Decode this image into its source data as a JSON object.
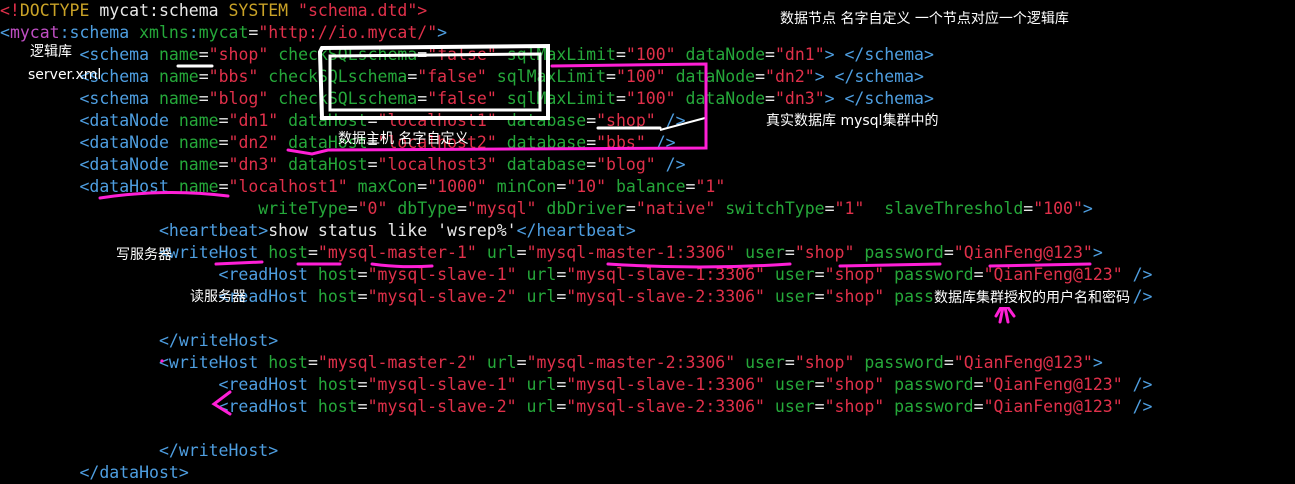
{
  "colors": {
    "background": "#000000",
    "text": "#e8e8e8",
    "tag": "#4e9ee0",
    "attribute": "#25a83a",
    "string": "#e0304a",
    "keyword": "#c9a227",
    "namespace": "#c04fc4",
    "pen_white": "#ffffff",
    "pen_magenta": "#ff1fd6"
  },
  "lines": [
    [
      [
        "doc",
        "<!"
      ],
      [
        "kw",
        "DOCTYPE"
      ],
      [
        "text",
        " mycat:schema "
      ],
      [
        "kw",
        "SYSTEM"
      ],
      [
        "text",
        " "
      ],
      [
        "str",
        "\"schema.dtd\""
      ],
      [
        "doc",
        ">"
      ]
    ],
    [
      [
        "tag",
        "<"
      ],
      [
        "ns",
        "mycat"
      ],
      [
        "tag",
        ":schema "
      ],
      [
        "attr",
        "xmlns"
      ],
      [
        "tag",
        ":"
      ],
      [
        "attr",
        "mycat"
      ],
      [
        "text",
        "="
      ],
      [
        "str",
        "\"http://io.mycat/\""
      ],
      [
        "tag",
        ">"
      ]
    ],
    [
      [
        "text",
        "        "
      ],
      [
        "tag",
        "<schema "
      ],
      [
        "attr",
        "name"
      ],
      [
        "text",
        "="
      ],
      [
        "str",
        "\"shop\""
      ],
      [
        "text",
        " "
      ],
      [
        "attr",
        "checkSQLschema"
      ],
      [
        "text",
        "="
      ],
      [
        "str",
        "\"false\""
      ],
      [
        "text",
        " "
      ],
      [
        "attr",
        "sqlMaxLimit"
      ],
      [
        "text",
        "="
      ],
      [
        "str",
        "\"100\""
      ],
      [
        "text",
        " "
      ],
      [
        "attr",
        "dataNode"
      ],
      [
        "text",
        "="
      ],
      [
        "str",
        "\"dn1\""
      ],
      [
        "tag",
        "> </schema>"
      ]
    ],
    [
      [
        "text",
        "        "
      ],
      [
        "tag",
        "<schema "
      ],
      [
        "attr",
        "name"
      ],
      [
        "text",
        "="
      ],
      [
        "str",
        "\"bbs\""
      ],
      [
        "text",
        " "
      ],
      [
        "attr",
        "checkSQLschema"
      ],
      [
        "text",
        "="
      ],
      [
        "str",
        "\"false\""
      ],
      [
        "text",
        " "
      ],
      [
        "attr",
        "sqlMaxLimit"
      ],
      [
        "text",
        "="
      ],
      [
        "str",
        "\"100\""
      ],
      [
        "text",
        " "
      ],
      [
        "attr",
        "dataNode"
      ],
      [
        "text",
        "="
      ],
      [
        "str",
        "\"dn2\""
      ],
      [
        "tag",
        "> </schema>"
      ]
    ],
    [
      [
        "text",
        "        "
      ],
      [
        "tag",
        "<schema "
      ],
      [
        "attr",
        "name"
      ],
      [
        "text",
        "="
      ],
      [
        "str",
        "\"blog\""
      ],
      [
        "text",
        " "
      ],
      [
        "attr",
        "checkSQLschema"
      ],
      [
        "text",
        "="
      ],
      [
        "str",
        "\"false\""
      ],
      [
        "text",
        " "
      ],
      [
        "attr",
        "sqlMaxLimit"
      ],
      [
        "text",
        "="
      ],
      [
        "str",
        "\"100\""
      ],
      [
        "text",
        " "
      ],
      [
        "attr",
        "dataNode"
      ],
      [
        "text",
        "="
      ],
      [
        "str",
        "\"dn3\""
      ],
      [
        "tag",
        "> </schema>"
      ]
    ],
    [
      [
        "text",
        "        "
      ],
      [
        "tag",
        "<dataNode "
      ],
      [
        "attr",
        "name"
      ],
      [
        "text",
        "="
      ],
      [
        "str",
        "\"dn1\""
      ],
      [
        "text",
        " "
      ],
      [
        "attr",
        "dataHost"
      ],
      [
        "text",
        "="
      ],
      [
        "str",
        "\"localhost1\""
      ],
      [
        "text",
        " "
      ],
      [
        "attr",
        "database"
      ],
      [
        "text",
        "="
      ],
      [
        "str",
        "\"shop\""
      ],
      [
        "text",
        " "
      ],
      [
        "tag",
        "/>"
      ]
    ],
    [
      [
        "text",
        "        "
      ],
      [
        "tag",
        "<dataNode "
      ],
      [
        "attr",
        "name"
      ],
      [
        "text",
        "="
      ],
      [
        "str",
        "\"dn2\""
      ],
      [
        "text",
        " "
      ],
      [
        "attr",
        "dataHost"
      ],
      [
        "text",
        "="
      ],
      [
        "str",
        "\"localhost2\""
      ],
      [
        "text",
        " "
      ],
      [
        "attr",
        "database"
      ],
      [
        "text",
        "="
      ],
      [
        "str",
        "\"bbs\""
      ],
      [
        "text",
        " "
      ],
      [
        "tag",
        "/>"
      ]
    ],
    [
      [
        "text",
        "        "
      ],
      [
        "tag",
        "<dataNode "
      ],
      [
        "attr",
        "name"
      ],
      [
        "text",
        "="
      ],
      [
        "str",
        "\"dn3\""
      ],
      [
        "text",
        " "
      ],
      [
        "attr",
        "dataHost"
      ],
      [
        "text",
        "="
      ],
      [
        "str",
        "\"localhost3\""
      ],
      [
        "text",
        " "
      ],
      [
        "attr",
        "database"
      ],
      [
        "text",
        "="
      ],
      [
        "str",
        "\"blog\""
      ],
      [
        "text",
        " "
      ],
      [
        "tag",
        "/>"
      ]
    ],
    [
      [
        "text",
        "        "
      ],
      [
        "tag",
        "<dataHost "
      ],
      [
        "attr",
        "name"
      ],
      [
        "text",
        "="
      ],
      [
        "str",
        "\"localhost1\""
      ],
      [
        "text",
        " "
      ],
      [
        "attr",
        "maxCon"
      ],
      [
        "text",
        "="
      ],
      [
        "str",
        "\"1000\""
      ],
      [
        "text",
        " "
      ],
      [
        "attr",
        "minCon"
      ],
      [
        "text",
        "="
      ],
      [
        "str",
        "\"10\""
      ],
      [
        "text",
        " "
      ],
      [
        "attr",
        "balance"
      ],
      [
        "text",
        "="
      ],
      [
        "str",
        "\"1\""
      ]
    ],
    [
      [
        "text",
        "                          "
      ],
      [
        "attr",
        "writeType"
      ],
      [
        "text",
        "="
      ],
      [
        "str",
        "\"0\""
      ],
      [
        "text",
        " "
      ],
      [
        "attr",
        "dbType"
      ],
      [
        "text",
        "="
      ],
      [
        "str",
        "\"mysql\""
      ],
      [
        "text",
        " "
      ],
      [
        "attr",
        "dbDriver"
      ],
      [
        "text",
        "="
      ],
      [
        "str",
        "\"native\""
      ],
      [
        "text",
        " "
      ],
      [
        "attr",
        "switchType"
      ],
      [
        "text",
        "="
      ],
      [
        "str",
        "\"1\""
      ],
      [
        "text",
        "  "
      ],
      [
        "attr",
        "slaveThreshold"
      ],
      [
        "text",
        "="
      ],
      [
        "str",
        "\"100\""
      ],
      [
        "tag",
        ">"
      ]
    ],
    [
      [
        "text",
        "                "
      ],
      [
        "tag",
        "<heartbeat>"
      ],
      [
        "text",
        "show status like 'wsrep%'"
      ],
      [
        "tag",
        "</heartbeat>"
      ]
    ],
    [
      [
        "text",
        "                "
      ],
      [
        "tag",
        "<writeHost "
      ],
      [
        "attr",
        "host"
      ],
      [
        "text",
        "="
      ],
      [
        "str",
        "\"mysql-master-1\""
      ],
      [
        "text",
        " "
      ],
      [
        "attr",
        "url"
      ],
      [
        "text",
        "="
      ],
      [
        "str",
        "\"mysql-master-1:3306\""
      ],
      [
        "text",
        " "
      ],
      [
        "attr",
        "user"
      ],
      [
        "text",
        "="
      ],
      [
        "str",
        "\"shop\""
      ],
      [
        "text",
        " "
      ],
      [
        "attr",
        "password"
      ],
      [
        "text",
        "="
      ],
      [
        "str",
        "\"QianFeng@123\""
      ],
      [
        "tag",
        ">"
      ]
    ],
    [
      [
        "text",
        "                      "
      ],
      [
        "tag",
        "<readHost "
      ],
      [
        "attr",
        "host"
      ],
      [
        "text",
        "="
      ],
      [
        "str",
        "\"mysql-slave-1\""
      ],
      [
        "text",
        " "
      ],
      [
        "attr",
        "url"
      ],
      [
        "text",
        "="
      ],
      [
        "str",
        "\"mysql-slave-1:3306\""
      ],
      [
        "text",
        " "
      ],
      [
        "attr",
        "user"
      ],
      [
        "text",
        "="
      ],
      [
        "str",
        "\"shop\""
      ],
      [
        "text",
        " "
      ],
      [
        "attr",
        "password"
      ],
      [
        "text",
        "="
      ],
      [
        "str",
        "\"QianFeng@123\""
      ],
      [
        "text",
        " "
      ],
      [
        "tag",
        "/>"
      ]
    ],
    [
      [
        "text",
        "                      "
      ],
      [
        "tag",
        "<readHost "
      ],
      [
        "attr",
        "host"
      ],
      [
        "text",
        "="
      ],
      [
        "str",
        "\"mysql-slave-2\""
      ],
      [
        "text",
        " "
      ],
      [
        "attr",
        "url"
      ],
      [
        "text",
        "="
      ],
      [
        "str",
        "\"mysql-slave-2:3306\""
      ],
      [
        "text",
        " "
      ],
      [
        "attr",
        "user"
      ],
      [
        "text",
        "="
      ],
      [
        "str",
        "\"shop\""
      ],
      [
        "text",
        " "
      ],
      [
        "attr",
        "password"
      ],
      [
        "text",
        "="
      ],
      [
        "str",
        "\"QianFeng@123\""
      ],
      [
        "text",
        " "
      ],
      [
        "tag",
        "/>"
      ]
    ],
    [
      [
        "text",
        ""
      ]
    ],
    [
      [
        "text",
        "                "
      ],
      [
        "tag",
        "</writeHost>"
      ]
    ],
    [
      [
        "text",
        "                "
      ],
      [
        "tag",
        "<writeHost "
      ],
      [
        "attr",
        "host"
      ],
      [
        "text",
        "="
      ],
      [
        "str",
        "\"mysql-master-2\""
      ],
      [
        "text",
        " "
      ],
      [
        "attr",
        "url"
      ],
      [
        "text",
        "="
      ],
      [
        "str",
        "\"mysql-master-2:3306\""
      ],
      [
        "text",
        " "
      ],
      [
        "attr",
        "user"
      ],
      [
        "text",
        "="
      ],
      [
        "str",
        "\"shop\""
      ],
      [
        "text",
        " "
      ],
      [
        "attr",
        "password"
      ],
      [
        "text",
        "="
      ],
      [
        "str",
        "\"QianFeng@123\""
      ],
      [
        "tag",
        ">"
      ]
    ],
    [
      [
        "text",
        "                      "
      ],
      [
        "tag",
        "<readHost "
      ],
      [
        "attr",
        "host"
      ],
      [
        "text",
        "="
      ],
      [
        "str",
        "\"mysql-slave-1\""
      ],
      [
        "text",
        " "
      ],
      [
        "attr",
        "url"
      ],
      [
        "text",
        "="
      ],
      [
        "str",
        "\"mysql-slave-1:3306\""
      ],
      [
        "text",
        " "
      ],
      [
        "attr",
        "user"
      ],
      [
        "text",
        "="
      ],
      [
        "str",
        "\"shop\""
      ],
      [
        "text",
        " "
      ],
      [
        "attr",
        "password"
      ],
      [
        "text",
        "="
      ],
      [
        "str",
        "\"QianFeng@123\""
      ],
      [
        "text",
        " "
      ],
      [
        "tag",
        "/>"
      ]
    ],
    [
      [
        "text",
        "                      "
      ],
      [
        "tag",
        "<readHost "
      ],
      [
        "attr",
        "host"
      ],
      [
        "text",
        "="
      ],
      [
        "str",
        "\"mysql-slave-2\""
      ],
      [
        "text",
        " "
      ],
      [
        "attr",
        "url"
      ],
      [
        "text",
        "="
      ],
      [
        "str",
        "\"mysql-slave-2:3306\""
      ],
      [
        "text",
        " "
      ],
      [
        "attr",
        "user"
      ],
      [
        "text",
        "="
      ],
      [
        "str",
        "\"shop\""
      ],
      [
        "text",
        " "
      ],
      [
        "attr",
        "password"
      ],
      [
        "text",
        "="
      ],
      [
        "str",
        "\"QianFeng@123\""
      ],
      [
        "text",
        " "
      ],
      [
        "tag",
        "/>"
      ]
    ],
    [
      [
        "text",
        ""
      ]
    ],
    [
      [
        "text",
        "                "
      ],
      [
        "tag",
        "</writeHost>"
      ]
    ],
    [
      [
        "text",
        "        "
      ],
      [
        "tag",
        "</dataHost>"
      ]
    ]
  ],
  "annotations": {
    "logical_db": "逻辑库",
    "server_xml": "server.xml",
    "data_node": "数据节点 名字自定义 一个节点对应一个逻辑库",
    "real_db": "真实数据库  mysql集群中的",
    "data_host": "数据主机 名字自定义",
    "write_server": "写服务器",
    "read_server": "读服务器",
    "cluster_auth": "数据库集群授权的用户名和密码"
  }
}
